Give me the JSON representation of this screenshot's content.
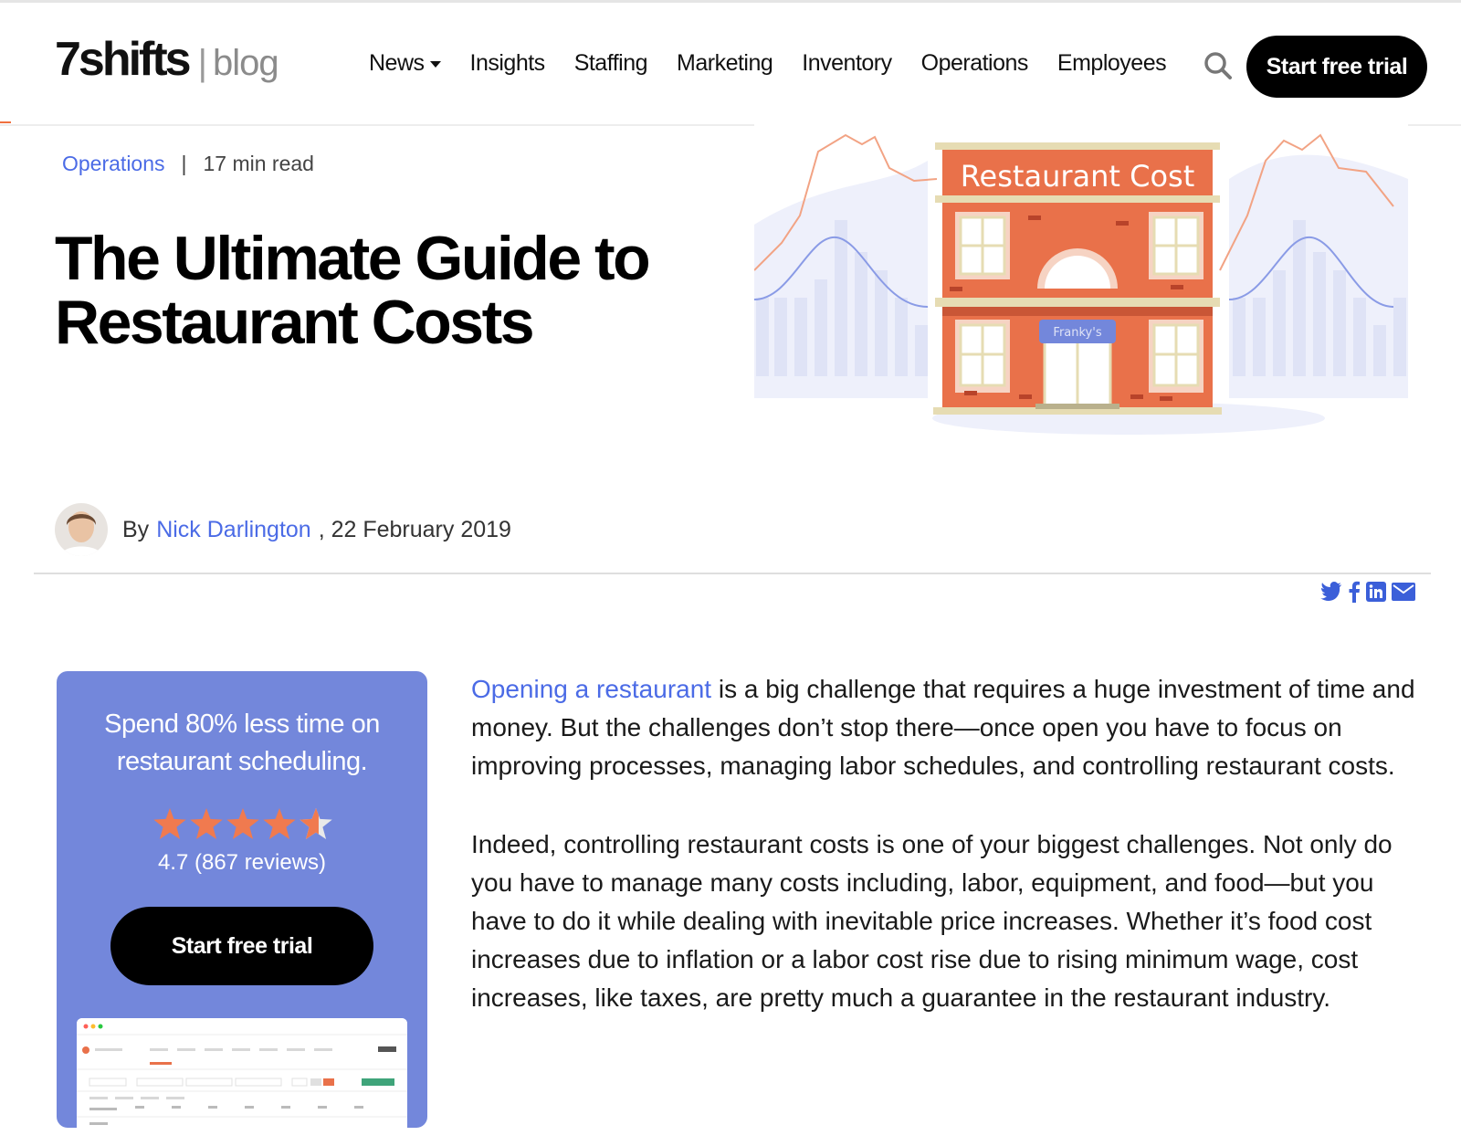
{
  "header": {
    "logo_main": "7shifts",
    "logo_sep": "|",
    "logo_sub": "blog",
    "nav": [
      {
        "label": "News",
        "has_dropdown": true
      },
      {
        "label": "Insights"
      },
      {
        "label": "Staffing"
      },
      {
        "label": "Marketing"
      },
      {
        "label": "Inventory"
      },
      {
        "label": "Operations"
      },
      {
        "label": "Employees"
      }
    ],
    "search_icon": "search-icon",
    "cta_label": "Start free trial"
  },
  "post": {
    "category": "Operations",
    "separator": "|",
    "read_time": "17 min read",
    "title": "The Ultimate Guide to Restaurant Costs",
    "hero": {
      "sign": "Restaurant Cost",
      "store_sign": "Franky's"
    },
    "byline": {
      "by": "By",
      "author": "Nick Darlington",
      "date": ", 22 February 2019"
    },
    "share_icons": [
      "twitter-icon",
      "facebook-icon",
      "linkedin-icon",
      "email-icon"
    ]
  },
  "promo": {
    "heading": "Spend 80% less time on restaurant scheduling.",
    "rating_value": 4.7,
    "rating_text": "4.7 (867 reviews)",
    "cta_label": "Start free trial"
  },
  "article": {
    "p1_link": "Opening a restaurant",
    "p1_rest": " is a big challenge that requires a huge investment of time and money. But the challenges don’t stop there—once open you have to focus on improving processes, managing labor schedules, and controlling restaurant costs.",
    "p2": "Indeed, controlling restaurant costs is one of your biggest challenges. Not only do you have to manage many costs including, labor, equipment, and food—but you have to do it while dealing with inevitable price increases. Whether it’s food cost increases due to inflation or a labor cost rise due to rising minimum wage, cost increases, like taxes, are pretty much a guarantee in the restaurant industry."
  },
  "colors": {
    "accent_blue": "#4b6be6",
    "promo_bg": "#7387db",
    "star": "#f07a4f",
    "building": "#e9714a"
  }
}
